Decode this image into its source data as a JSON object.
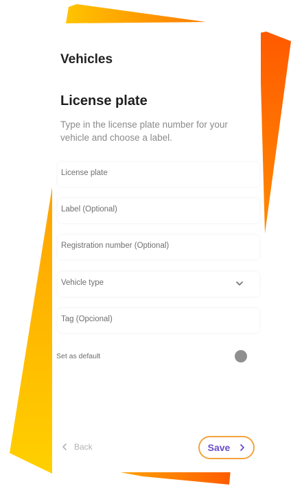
{
  "header": {
    "title": "Vehicles"
  },
  "section": {
    "title": "License plate",
    "description": "Type in the license plate number for your vehicle and choose a label."
  },
  "fields": [
    {
      "label": "License plate",
      "type": "text"
    },
    {
      "label": "Label (Optional)",
      "type": "text"
    },
    {
      "label": "Registration number (Optional)",
      "type": "text"
    },
    {
      "label": "Vehicle type",
      "type": "select",
      "icon": "chevron-down-icon"
    },
    {
      "label": "Tag (Opcional)",
      "type": "text"
    }
  ],
  "default_toggle": {
    "label": "Set as default",
    "on": false
  },
  "footer": {
    "back_label": "Back",
    "save_label": "Save",
    "back_icon": "chevron-left-icon",
    "save_icon": "chevron-right-icon"
  },
  "colors": {
    "accent": "#6a4cc9",
    "highlight": "#f4a23c",
    "decor_orange": "#ff6a00",
    "decor_yellow": "#ffc200"
  }
}
